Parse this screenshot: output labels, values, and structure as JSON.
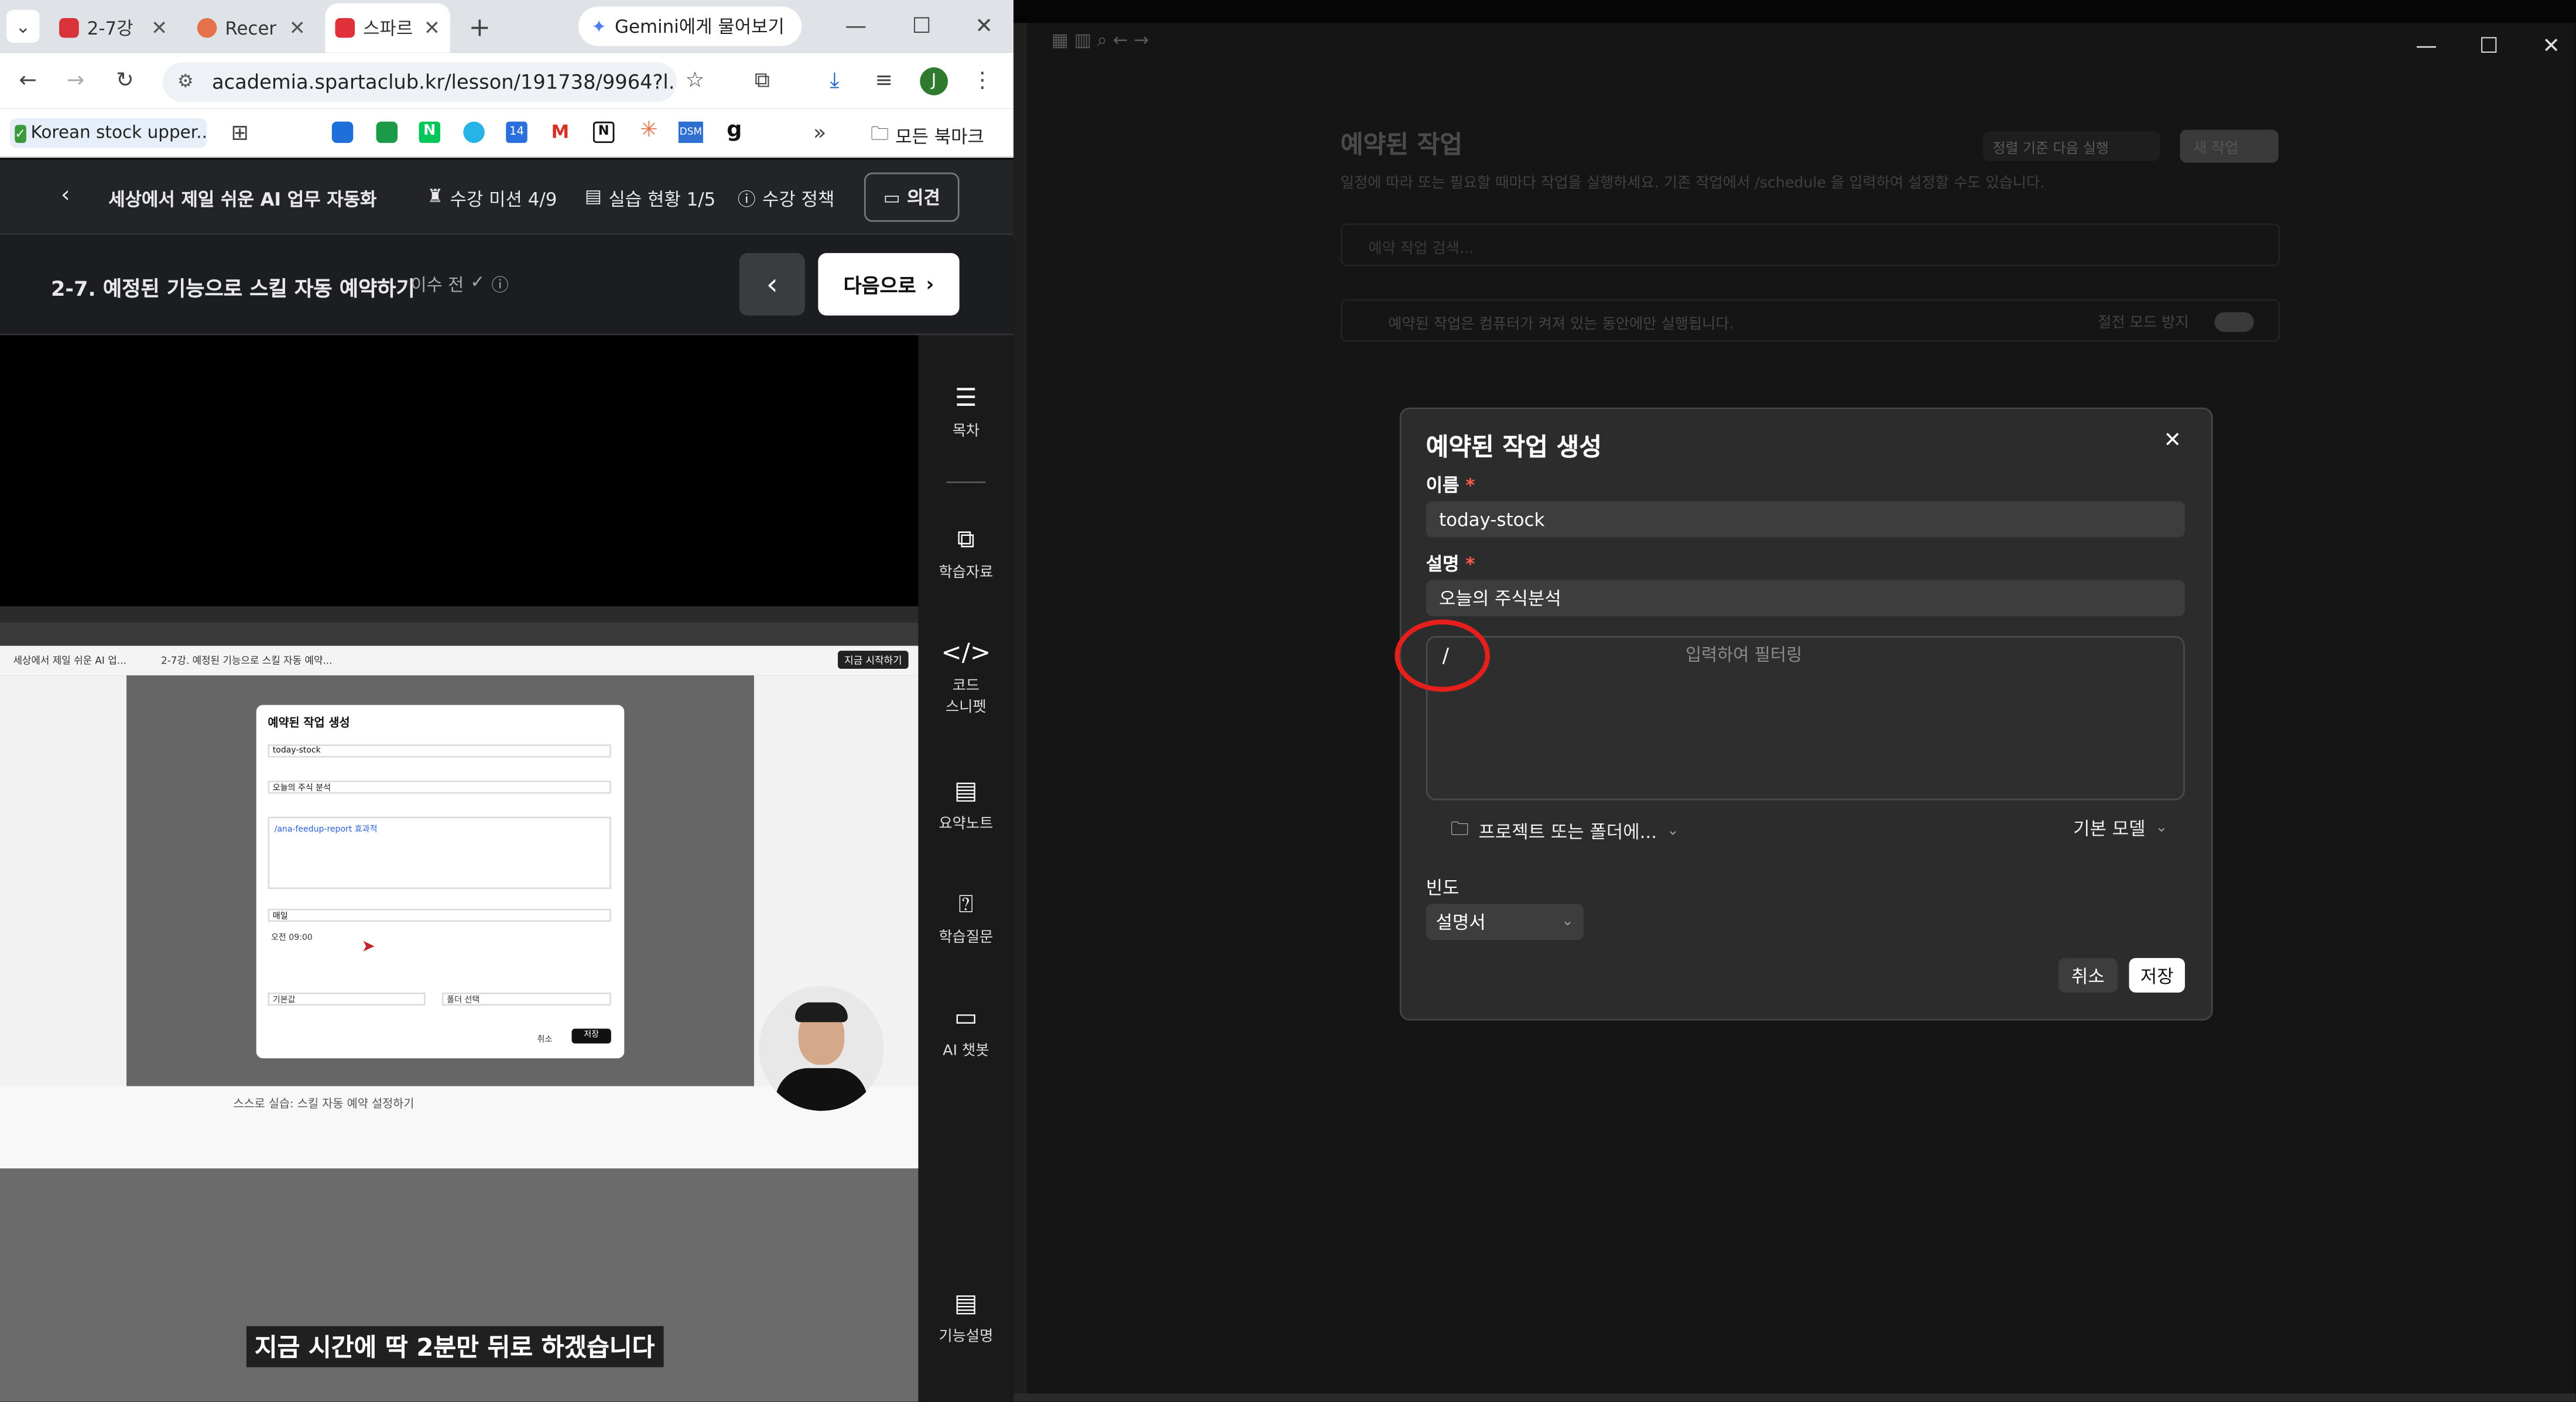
{
  "browser": {
    "tabs": [
      {
        "label": "2-7강",
        "color": "#d9323a"
      },
      {
        "label": "Recer",
        "color": "#e5714c"
      },
      {
        "label": "스파르",
        "color": "#e0313b"
      }
    ],
    "gemini_label": "Gemini에게 물어보기",
    "url": "academia.spartaclub.kr/lesson/191738/9964?l...",
    "profile_initial": "J",
    "bookmarks": {
      "first": "Korean stock upper...",
      "folder": "모든 북마크",
      "icons": [
        "grid-icon",
        "blue-app-icon",
        "green-app-icon",
        "naver-icon",
        "circle-app-icon",
        "calendar-icon",
        "gmail-icon",
        "notion-icon",
        "claude-icon",
        "dsm-icon",
        "g-icon"
      ],
      "overflow": "»"
    }
  },
  "course_header": {
    "title": "세상에서 제일 쉬운 AI 업무 자동화",
    "mission": "수강 미션 4/9",
    "practice": "실습 현황 1/5",
    "policy": "수강 정책",
    "feedback": "의견"
  },
  "lesson": {
    "title": "2-7. 예정된 기능으로 스킬 자동 예약하기",
    "status": "이수 전",
    "prev_icon": "‹",
    "next_label": "다음으로"
  },
  "video": {
    "subtitle": "지금 시간에 딱 2분만 뒤로 하겠습니다",
    "inner": {
      "tab1": "세상에서 제일 쉬운 AI 업...",
      "tab2": "2-7강. 예정된 기능으로 스킬 자동 예약...",
      "start_btn": "지금 시작하기",
      "dialog_title": "예약된 작업 생성",
      "name_value": "today-stock",
      "desc_value": "오늘의 주식 분석",
      "prompt_value": "/ana-feedup-report 효과적",
      "freq_value": "매일",
      "time_value": "오전 09:00",
      "model_value": "기본값",
      "folder_value": "폴더 선택",
      "cancel": "취소",
      "save": "저장",
      "bottom_text": "스스로 실습: 스킬 자동 예약 설정하기"
    }
  },
  "sidebar_rail": {
    "toc": "목차",
    "materials": "학습자료",
    "code1": "코드",
    "code2": "스니펫",
    "notes": "요약노트",
    "question": "학습질문",
    "chatbot": "AI 챗봇",
    "features": "기능설명"
  },
  "app_bg": {
    "title": "예약된 작업",
    "desc": "일정에 따라 또는 필요할 때마다 작업을 실행하세요. 기존 작업에서 /schedule 을 입력하여 설정할 수도 있습니다.",
    "sort": "정렬 기준 다음 실행",
    "new_task": "새 작업",
    "search_placeholder": "예약 작업 검색...",
    "notice": "예약된 작업은 컴퓨터가 켜져 있는 동안에만 실행됩니다.",
    "keep_awake": "절전 모드 방지"
  },
  "dialog": {
    "title": "예약된 작업 생성",
    "close_icon": "✕",
    "name_label": "이름",
    "name_value": "today-stock",
    "desc_label": "설명",
    "desc_value": "오늘의 주식분석",
    "prompt_value": "/",
    "prompt_hint": "입력하여 필터링",
    "project_label": "프로젝트 또는 폴더에...",
    "model_label": "기본 모델",
    "freq_label": "빈도",
    "freq_value": "설명서",
    "cancel": "취소",
    "save": "저장",
    "required_mark": "*"
  },
  "colors": {
    "annotation_circle": "#e5201c",
    "required": "#ff5a4e",
    "rail_bg": "#1a1a1a",
    "dialog_bg": "#2c2c2c"
  }
}
